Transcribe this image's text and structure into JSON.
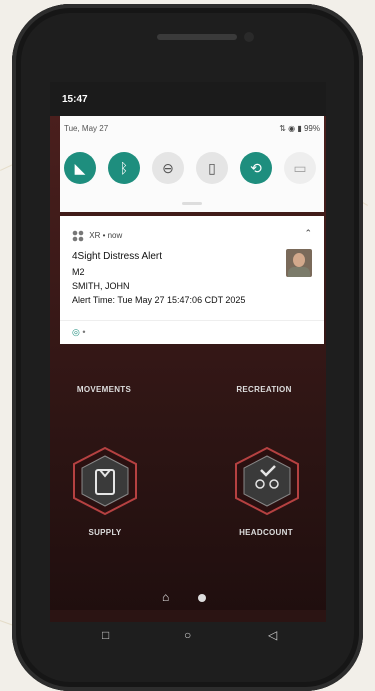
{
  "status_bar": {
    "time": "15:47"
  },
  "quick_settings": {
    "date": "Tue, May 27",
    "battery": "99%",
    "tiles": [
      {
        "name": "wifi-icon",
        "label": "Wi-Fi",
        "state": "on"
      },
      {
        "name": "bluetooth-icon",
        "label": "Bluetooth",
        "state": "on"
      },
      {
        "name": "do-not-disturb-icon",
        "label": "Do Not Disturb",
        "state": "off"
      },
      {
        "name": "flashlight-icon",
        "label": "Flashlight",
        "state": "off"
      },
      {
        "name": "auto-rotate-icon",
        "label": "Auto-rotate",
        "state": "on"
      },
      {
        "name": "battery-saver-icon",
        "label": "Battery Saver",
        "state": "disabled"
      }
    ]
  },
  "notification": {
    "app": "XR • now",
    "title": "4Sight Distress Alert",
    "line1": "M2",
    "line2": "SMITH, JOHN",
    "line3": "Alert Time: Tue May 27 15:47:06 CDT 2025",
    "footer": "•"
  },
  "app_tiles": {
    "movements": "MOVEMENTS",
    "recreation": "RECREATION",
    "supply": "SUPPLY",
    "headcount": "HEADCOUNT"
  },
  "dock": [
    "cell-check-icon",
    "add-officer-icon",
    "transfer-icon",
    "checklist-icon",
    "brand-icon"
  ],
  "nav": [
    "back-icon",
    "home-icon",
    "recents-icon"
  ],
  "colors": {
    "accent": "#1e8e7e",
    "app_bg": "#3a1a1a",
    "card": "#ffffff"
  }
}
